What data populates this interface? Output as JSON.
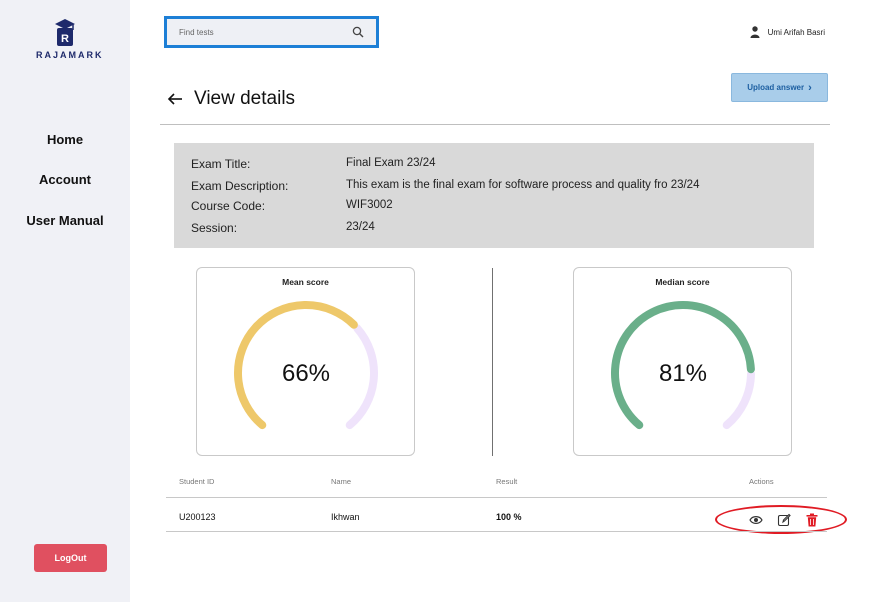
{
  "app": {
    "logo_text": "RAJAMARK",
    "logo_letter": "R"
  },
  "sidebar": {
    "items": [
      {
        "label": "Home"
      },
      {
        "label": "Account"
      },
      {
        "label": "User Manual"
      }
    ],
    "logout_label": "LogOut"
  },
  "search": {
    "placeholder": "Find tests",
    "value": "",
    "icon": "search-icon"
  },
  "user": {
    "name": "Umi Arifah Basri",
    "icon": "user-icon"
  },
  "page": {
    "title": "View details",
    "back_icon": "arrow-left-icon"
  },
  "upload": {
    "label": "Upload answer",
    "chevron": "›"
  },
  "exam": {
    "title_label": "Exam Title:",
    "title": "Final Exam 23/24",
    "description_label": "Exam Description:",
    "description": "This exam is the final exam for software process and quality fro 23/24",
    "course_code_label": "Course Code:",
    "course_code": "WIF3002",
    "session_label": "Session:",
    "session": "23/24"
  },
  "stats": {
    "mean": {
      "title": "Mean score",
      "value_text": "66%",
      "value": 66,
      "color": "#eec86a",
      "track_color": "#efe3fb"
    },
    "median": {
      "title": "Median score",
      "value_text": "81%",
      "value": 81,
      "color": "#6aaf8a",
      "track_color": "#efe3fb"
    }
  },
  "table": {
    "headers": {
      "student_id": "Student ID",
      "name": "Name",
      "result": "Result",
      "actions": "Actions"
    },
    "rows": [
      {
        "student_id": "U200123",
        "name": "Ikhwan",
        "result": "100 %"
      }
    ],
    "action_icons": [
      "eye-icon",
      "edit-icon",
      "trash-icon"
    ],
    "highlight_color": "#e01b24"
  },
  "colors": {
    "accent": "#1d7fd6",
    "logout": "#e05060",
    "upload_bg": "#a9cdea",
    "delete": "#e01b24"
  }
}
